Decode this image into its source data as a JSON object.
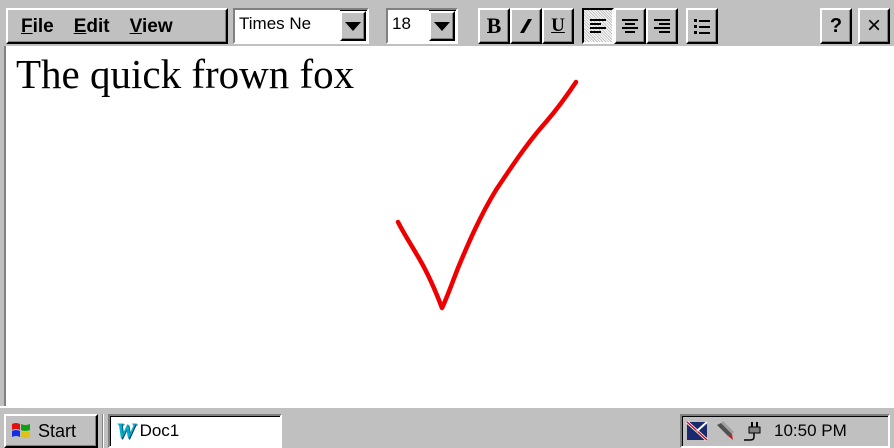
{
  "menu": {
    "file": {
      "mnemonic": "F",
      "rest": "ile"
    },
    "edit": {
      "mnemonic": "E",
      "rest": "dit"
    },
    "view": {
      "mnemonic": "V",
      "rest": "iew"
    }
  },
  "toolbar": {
    "font_name": "Times Ne",
    "font_size": "18",
    "bold_label": "B",
    "underline_label": "U",
    "help_label": "?",
    "close_label": "×",
    "active_alignment": "left"
  },
  "document": {
    "text": "The quick frown fox",
    "ink_color": "#ee0000"
  },
  "taskbar": {
    "start_label": "Start",
    "task_icon_letter": "W",
    "task_label": "Doc1",
    "clock": "10:50 PM"
  },
  "icons": {
    "start": "windows-flag-icon",
    "task": "word-doc-icon",
    "tray": [
      "network-icon",
      "stylus-icon",
      "power-plug-icon"
    ]
  }
}
